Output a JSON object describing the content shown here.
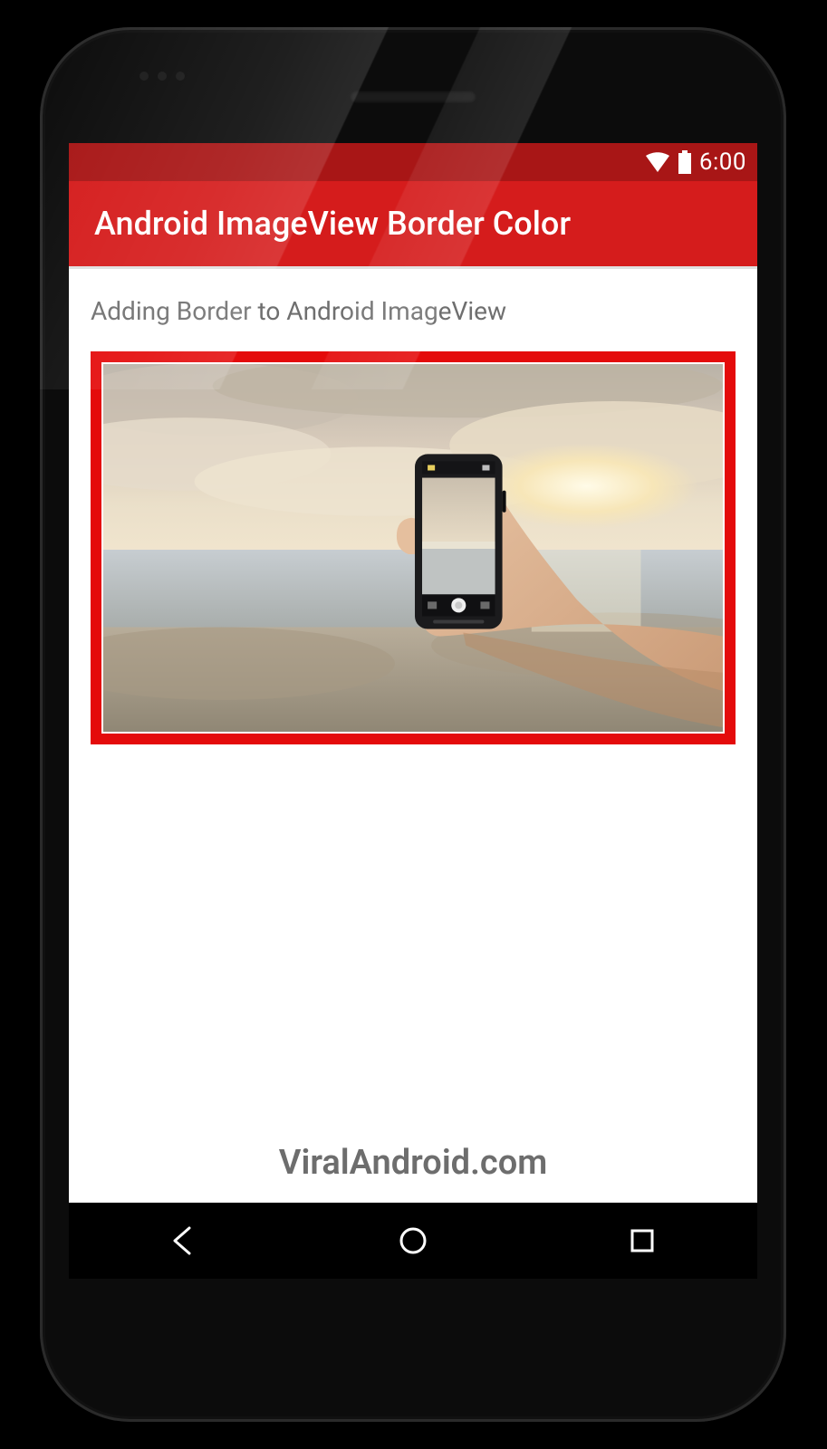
{
  "status_bar": {
    "time": "6:00",
    "wifi_icon": "wifi-icon",
    "battery_icon": "battery-full-icon"
  },
  "action_bar": {
    "title": "Android ImageView Border Color"
  },
  "content": {
    "subtitle": "Adding Border to Android ImageView",
    "image": {
      "border_color": "#e40b0b",
      "description": "hand-holding-phone-beach-sunset"
    },
    "footer_brand": "ViralAndroid.com"
  },
  "navigation": {
    "back_icon": "nav-back-icon",
    "home_icon": "nav-home-icon",
    "recent_icon": "nav-recent-icon"
  },
  "colors": {
    "status_bar_bg": "#a81616",
    "action_bar_bg": "#d51c1c",
    "border": "#e40b0b"
  }
}
